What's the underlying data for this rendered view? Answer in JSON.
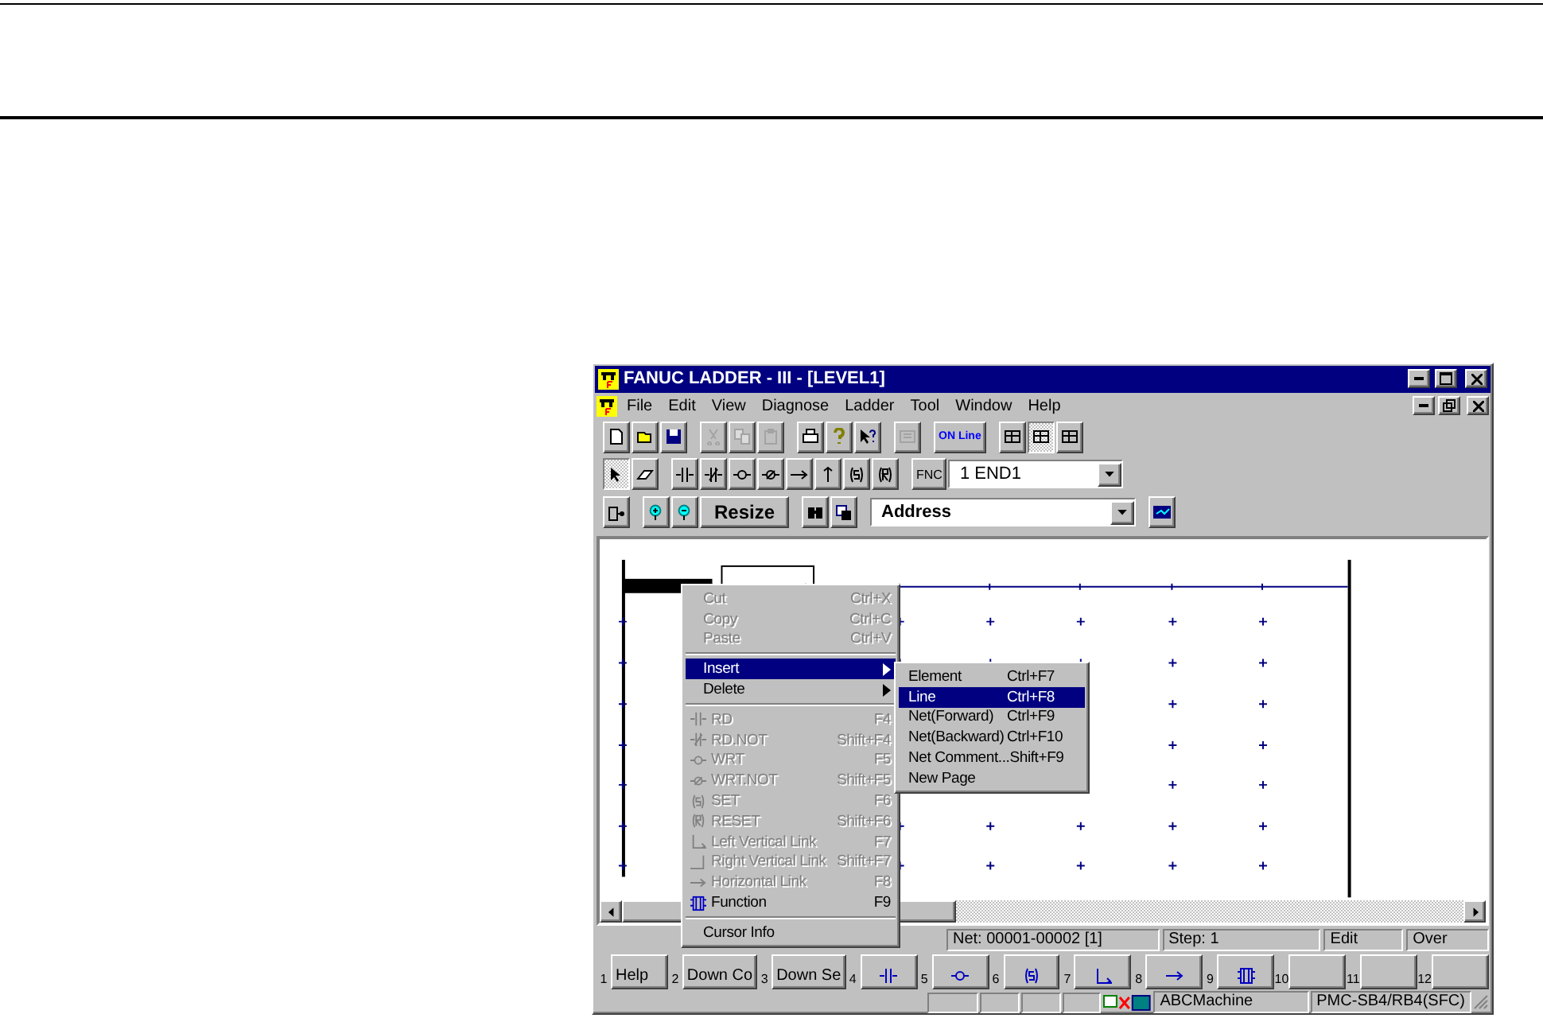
{
  "window": {
    "title": "FANUC LADDER - III - [LEVEL1]"
  },
  "menu_bar": [
    "File",
    "Edit",
    "View",
    "Diagnose",
    "Ladder",
    "Tool",
    "Window",
    "Help"
  ],
  "toolbars": [
    [
      {
        "kind": "icon",
        "disabled": false,
        "pressed": false
      },
      {
        "kind": "icon",
        "disabled": false,
        "pressed": false
      },
      {
        "kind": "icon",
        "disabled": false,
        "pressed": false
      },
      {
        "kind": "separator"
      },
      {
        "kind": "icon",
        "disabled": true,
        "pressed": false
      },
      {
        "kind": "icon",
        "disabled": true,
        "pressed": false
      },
      {
        "kind": "icon",
        "disabled": true,
        "pressed": false
      },
      {
        "kind": "separator"
      },
      {
        "kind": "icon",
        "disabled": false,
        "pressed": false
      },
      {
        "kind": "icon",
        "disabled": false,
        "pressed": false
      },
      {
        "kind": "icon",
        "disabled": false,
        "pressed": false
      },
      {
        "kind": "separator"
      },
      {
        "kind": "icon",
        "disabled": true,
        "pressed": false
      },
      {
        "kind": "separator"
      },
      {
        "kind": "text",
        "label": "ON Line",
        "disabled": false
      },
      {
        "kind": "separator"
      },
      {
        "kind": "icon",
        "disabled": false,
        "pressed": false
      },
      {
        "kind": "icon",
        "disabled": false,
        "pressed": true
      },
      {
        "kind": "icon",
        "disabled": false,
        "pressed": false
      }
    ],
    [
      {
        "kind": "icon",
        "disabled": false,
        "pressed": true
      },
      {
        "kind": "icon",
        "disabled": false,
        "pressed": false
      },
      {
        "kind": "separator"
      },
      {
        "kind": "icon",
        "disabled": false,
        "pressed": false
      },
      {
        "kind": "icon",
        "disabled": false,
        "pressed": false
      },
      {
        "kind": "icon",
        "disabled": false,
        "pressed": false
      },
      {
        "kind": "icon",
        "disabled": false,
        "pressed": false
      },
      {
        "kind": "icon",
        "disabled": false,
        "pressed": false
      },
      {
        "kind": "icon",
        "disabled": false,
        "pressed": false
      },
      {
        "kind": "icon",
        "disabled": false,
        "pressed": false
      },
      {
        "kind": "icon",
        "disabled": false,
        "pressed": false
      },
      {
        "kind": "separator"
      },
      {
        "kind": "text",
        "label": "FNC",
        "disabled": false
      },
      {
        "kind": "dropdown",
        "value": "1 END1"
      }
    ],
    [
      {
        "kind": "icon",
        "disabled": false,
        "pressed": false
      },
      {
        "kind": "separator"
      },
      {
        "kind": "icon",
        "disabled": false,
        "pressed": false
      },
      {
        "kind": "icon",
        "disabled": false,
        "pressed": false
      },
      {
        "kind": "text",
        "label": "Resize",
        "disabled": false
      },
      {
        "kind": "separator"
      },
      {
        "kind": "icon",
        "disabled": false,
        "pressed": false
      },
      {
        "kind": "icon",
        "disabled": false,
        "pressed": false
      },
      {
        "kind": "separator"
      },
      {
        "kind": "dropdown",
        "value": "Address"
      },
      {
        "kind": "separator"
      },
      {
        "kind": "icon",
        "disabled": false,
        "pressed": false
      }
    ]
  ],
  "context_menu": [
    {
      "kind": "item",
      "label": "Cut",
      "shortcut": "Ctrl+X",
      "disabled": true,
      "selected": false
    },
    {
      "kind": "item",
      "label": "Copy",
      "shortcut": "Ctrl+C",
      "disabled": true,
      "selected": false
    },
    {
      "kind": "item",
      "label": "Paste",
      "shortcut": "Ctrl+V",
      "disabled": true,
      "selected": false
    },
    {
      "kind": "separator"
    },
    {
      "kind": "submenu",
      "label": "Insert",
      "disabled": false,
      "selected": true
    },
    {
      "kind": "submenu",
      "label": "Delete",
      "disabled": false,
      "selected": false
    },
    {
      "kind": "separator"
    },
    {
      "kind": "item",
      "label": "RD",
      "shortcut": "F4",
      "disabled": true,
      "selected": false
    },
    {
      "kind": "item",
      "label": "RD.NOT",
      "shortcut": "Shift+F4",
      "disabled": true,
      "selected": false
    },
    {
      "kind": "item",
      "label": "WRT",
      "shortcut": "F5",
      "disabled": true,
      "selected": false
    },
    {
      "kind": "item",
      "label": "WRT.NOT",
      "shortcut": "Shift+F5",
      "disabled": true,
      "selected": false
    },
    {
      "kind": "item",
      "label": "SET",
      "shortcut": "F6",
      "disabled": true,
      "selected": false
    },
    {
      "kind": "item",
      "label": "RESET",
      "shortcut": "Shift+F6",
      "disabled": true,
      "selected": false
    },
    {
      "kind": "item",
      "label": "Left Vertical Link",
      "shortcut": "F7",
      "disabled": true,
      "selected": false
    },
    {
      "kind": "item",
      "label": "Right Vertical Link",
      "shortcut": "Shift+F7",
      "disabled": true,
      "selected": false
    },
    {
      "kind": "item",
      "label": "Horizontal Link",
      "shortcut": "F8",
      "disabled": true,
      "selected": false
    },
    {
      "kind": "item",
      "label": "Function",
      "shortcut": "F9",
      "disabled": false,
      "selected": false
    },
    {
      "kind": "separator"
    },
    {
      "kind": "item",
      "label": "Cursor Info",
      "disabled": false,
      "selected": false
    }
  ],
  "submenu": [
    {
      "label": "Element",
      "shortcut": "Ctrl+F7",
      "selected": false
    },
    {
      "label": "Line",
      "shortcut": "Ctrl+F8",
      "selected": true
    },
    {
      "label": "Net(Forward)",
      "shortcut": "Ctrl+F9",
      "selected": false
    },
    {
      "label": "Net(Backward)",
      "shortcut": "Ctrl+F10",
      "selected": false
    },
    {
      "label": "Net Comment...",
      "shortcut": "Shift+F9",
      "selected": false
    },
    {
      "label": "New Page",
      "selected": false
    }
  ],
  "status_bar": [
    "Net: 00001-00002 [1]",
    "Step: 1",
    "Edit",
    "Over"
  ],
  "function_keys": [
    {
      "number": "1",
      "kind": "text",
      "label": "Help"
    },
    {
      "number": "2",
      "kind": "text",
      "label": "Down Co"
    },
    {
      "number": "3",
      "kind": "text",
      "label": "Down Se"
    },
    {
      "number": "4",
      "kind": "icon"
    },
    {
      "number": "5",
      "kind": "icon"
    },
    {
      "number": "6",
      "kind": "icon"
    },
    {
      "number": "7",
      "kind": "icon"
    },
    {
      "number": "8",
      "kind": "icon"
    },
    {
      "number": "9",
      "kind": "icon"
    },
    {
      "number": "10",
      "kind": "empty"
    },
    {
      "number": "11",
      "kind": "empty"
    },
    {
      "number": "12",
      "kind": "empty"
    }
  ],
  "machine_bar": {
    "machine": "ABCMachine",
    "model": "PMC-SB4/RB4(SFC)"
  }
}
